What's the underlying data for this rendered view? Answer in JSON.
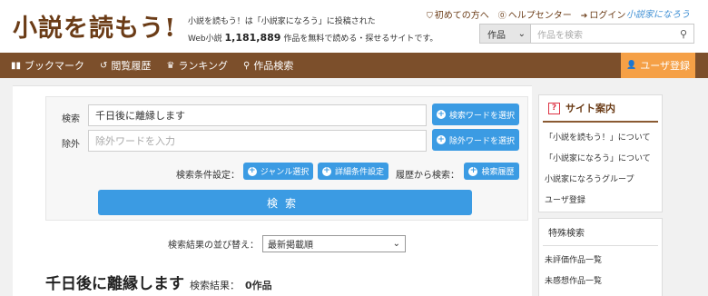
{
  "header": {
    "logo": "小説を読もう!",
    "tagline": "小説を読もう！は「小説家になろう」に投稿された",
    "count_prefix": "Web小説",
    "count": "1,181,889",
    "count_suffix": "作品を無料で読める・探せるサイトです。",
    "links": [
      {
        "icon": "shield-icon",
        "glyph": "⛉",
        "label": "初めての方へ"
      },
      {
        "icon": "help-icon",
        "glyph": "⓪",
        "label": "ヘルプセンター"
      },
      {
        "icon": "login-icon",
        "glyph": "➔",
        "label": "ログイン"
      }
    ],
    "narou_logo": "小説家になろう",
    "search": {
      "select": "作品",
      "placeholder": "作品を検索"
    }
  },
  "nav": {
    "items": [
      {
        "icon": "bookmark-icon",
        "glyph": "▮▮",
        "label": "ブックマーク"
      },
      {
        "icon": "history-icon",
        "glyph": "↺",
        "label": "閲覧履歴"
      },
      {
        "icon": "crown-icon",
        "glyph": "♛",
        "label": "ランキング"
      },
      {
        "icon": "search-icon",
        "glyph": "⚲",
        "label": "作品検索"
      }
    ],
    "register": "ユーザ登録",
    "register_glyph": "👤"
  },
  "search_form": {
    "keyword_label": "検索",
    "keyword_value": "千日後に離縁します",
    "keyword_btn": "検索ワードを選択",
    "exclude_label": "除外",
    "exclude_placeholder": "除外ワードを入力",
    "exclude_btn": "除外ワードを選択",
    "conditions_label": "検索条件設定：",
    "genre_btn": "ジャンル選択",
    "detail_btn": "詳細条件設定",
    "history_label": "履歴から検索：",
    "history_btn": "検索履歴",
    "submit": "検索"
  },
  "sort": {
    "label": "検索結果の並び替え：",
    "selected": "最新掲載順"
  },
  "result": {
    "query": "千日後に離縁します",
    "label": "検索結果：",
    "count": "0作品"
  },
  "sidebar": {
    "guide_title": "サイト案内",
    "guide_items": [
      "「小説を読もう！」について",
      "「小説家になろう」について",
      "小説家になろうグループ",
      "ユーザ登録"
    ],
    "special_title": "特殊検索",
    "special_items": [
      "未評価作品一覧",
      "未感想作品一覧"
    ]
  },
  "colors": {
    "brand_brown": "#7c4f2b",
    "accent_blue": "#3b9be3",
    "register_orange": "#f5a046"
  }
}
